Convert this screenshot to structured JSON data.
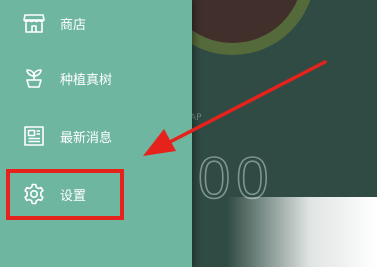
{
  "drawer": {
    "items": [
      {
        "label": "商店",
        "icon": "store-icon"
      },
      {
        "label": "种植真树",
        "icon": "sprout-icon"
      },
      {
        "label": "最新消息",
        "icon": "newspaper-icon"
      },
      {
        "label": "设置",
        "icon": "gear-icon"
      }
    ]
  },
  "background": {
    "timer_text": "00",
    "small_text": "AP"
  },
  "annotation": {
    "highlight_color": "#e5221b",
    "target": "设置"
  },
  "colors": {
    "drawer_bg": "#6fb6a1",
    "app_bg": "#2f4b43"
  }
}
